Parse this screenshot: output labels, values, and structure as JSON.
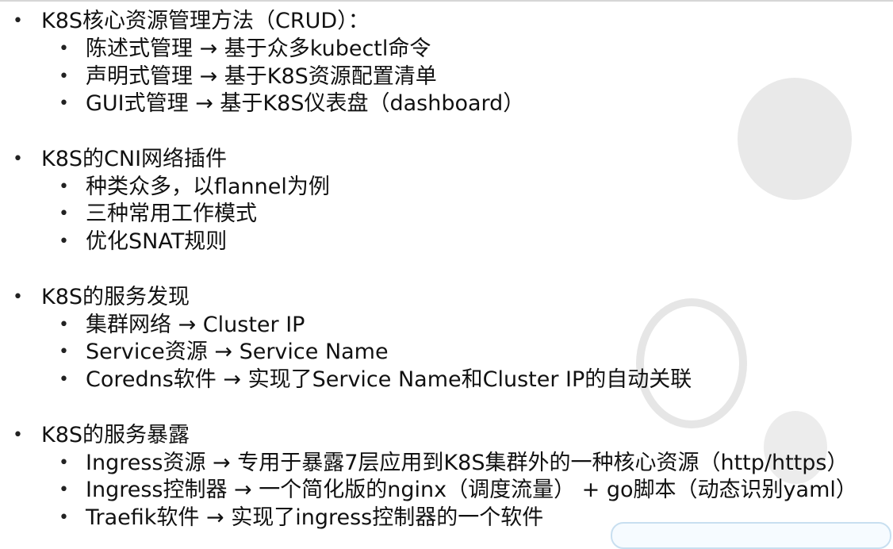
{
  "bullet_char": "•",
  "sections": [
    {
      "heading": "K8S核心资源管理方法（CRUD）：",
      "items": [
        "陈述式管理 → 基于众多kubectl命令",
        "声明式管理 → 基于K8S资源配置清单",
        "GUI式管理 → 基于K8S仪表盘（dashboard）"
      ]
    },
    {
      "heading": "K8S的CNI网络插件",
      "items": [
        "种类众多，以flannel为例",
        "三种常用工作模式",
        "优化SNAT规则"
      ]
    },
    {
      "heading": "K8S的服务发现",
      "items": [
        "集群网络 → Cluster IP",
        "Service资源 → Service Name",
        "Coredns软件 → 实现了Service Name和Cluster IP的自动关联"
      ]
    },
    {
      "heading": "K8S的服务暴露",
      "items": [
        "Ingress资源 → 专用于暴露7层应用到K8S集群外的一种核心资源（http/https）",
        "Ingress控制器 → 一个简化版的nginx（调度流量） + go脚本（动态识别yaml）",
        "Traefik软件 → 实现了ingress控制器的一个软件"
      ]
    }
  ]
}
